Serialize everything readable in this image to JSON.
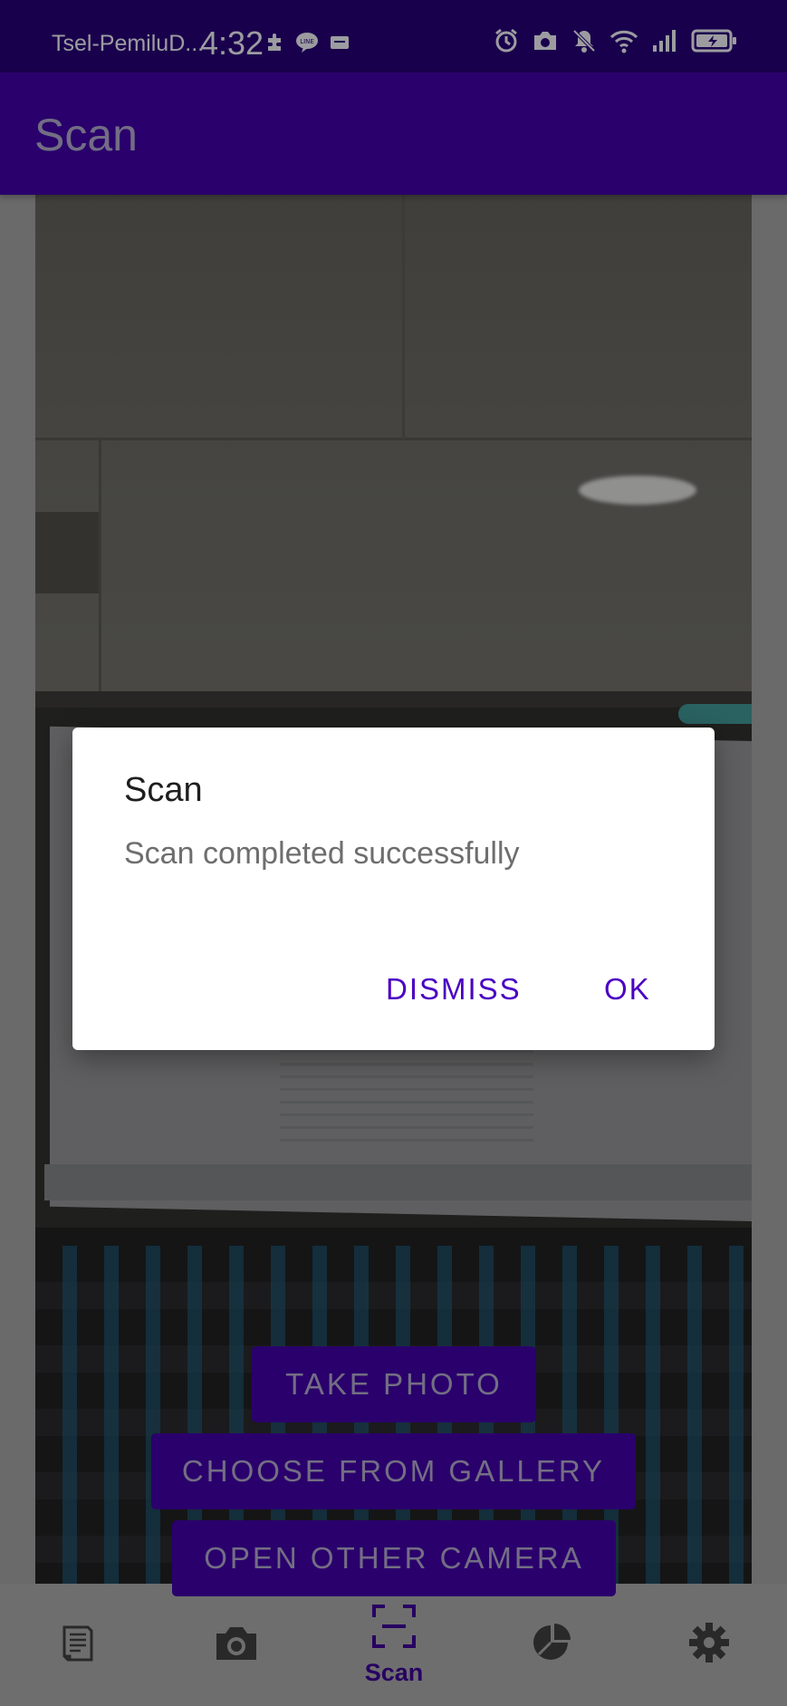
{
  "status_bar": {
    "carrier": "Tsel-PemiluD...",
    "time": "4:32",
    "left_icons": [
      "puzzle-icon",
      "line-chat-icon",
      "message-icon"
    ],
    "right_icons": [
      "alarm-icon",
      "camera-icon",
      "bell-off-icon",
      "wifi-icon",
      "signal-icon",
      "battery-charging-icon"
    ]
  },
  "app_bar": {
    "title": "Scan"
  },
  "actions": {
    "take_photo": "TAKE PHOTO",
    "choose_gallery": "CHOOSE FROM GALLERY",
    "open_camera": "OPEN OTHER CAMERA"
  },
  "bottom_nav": {
    "items": [
      {
        "icon": "receipt-icon",
        "label": ""
      },
      {
        "icon": "camera-icon",
        "label": ""
      },
      {
        "icon": "scan-icon",
        "label": "Scan",
        "selected": true
      },
      {
        "icon": "pie-chart-icon",
        "label": ""
      },
      {
        "icon": "settings-icon",
        "label": ""
      }
    ]
  },
  "dialog": {
    "title": "Scan",
    "message": "Scan completed successfully",
    "dismiss_label": "DISMISS",
    "ok_label": "OK"
  },
  "colors": {
    "status_bar": "#260070",
    "app_bar": "#3f00a0",
    "accent": "#4a00c2",
    "bottom_nav": "#a3a3a3"
  }
}
